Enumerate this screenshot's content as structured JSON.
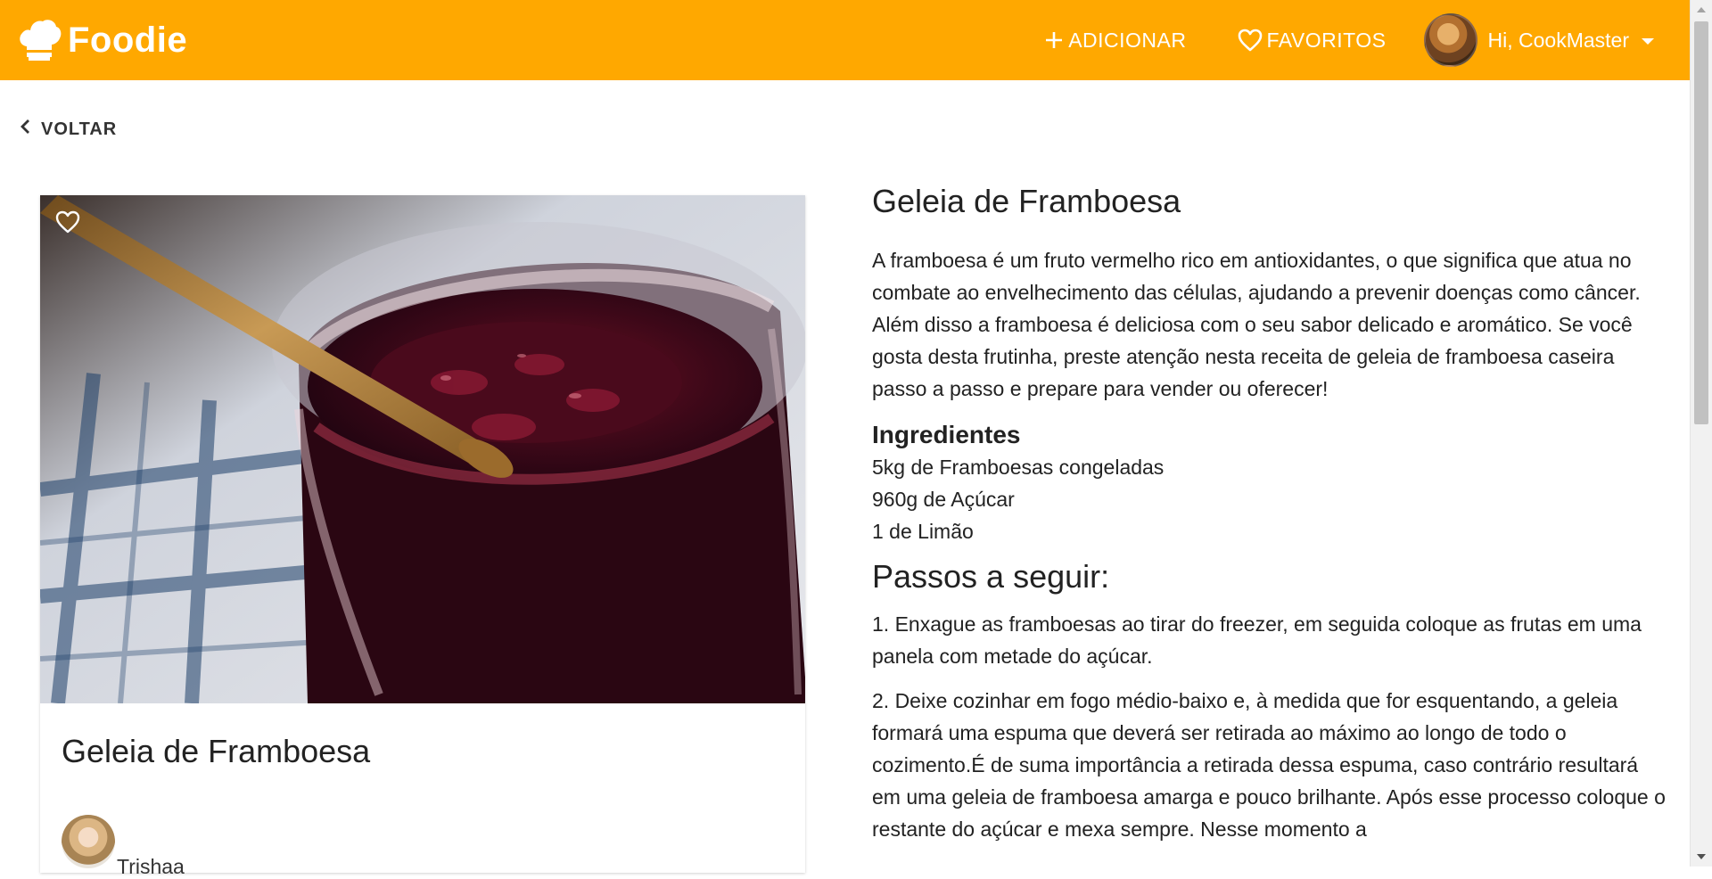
{
  "header": {
    "brand": "Foodie",
    "add_label": "ADICIONAR",
    "favorites_label": "FAVORITOS",
    "user_greeting": "Hi, CookMaster",
    "colors": {
      "accent": "#ffa800",
      "text": "#ffffff"
    }
  },
  "nav": {
    "back_label": "VOLTAR"
  },
  "card": {
    "title": "Geleia de Framboesa",
    "author": "Trishaa",
    "image_icon": "favorite-outline-icon"
  },
  "recipe": {
    "title": "Geleia de Framboesa",
    "description": "A framboesa é um fruto vermelho rico em antioxidantes, o que significa que atua no combate ao envelhecimento das células, ajudando a prevenir doenças como câncer. Além disso a framboesa é deliciosa com o seu sabor delicado e aromático. Se você gosta desta frutinha, preste atenção nesta receita de geleia de framboesa caseira passo a passo e prepare para vender ou oferecer!",
    "ingredients_heading": "Ingredientes",
    "ingredients": [
      "5kg de Framboesas congeladas",
      "960g de Açúcar",
      "1 de Limão"
    ],
    "steps_heading": "Passos a seguir:",
    "steps": [
      "1. Enxague as framboesas ao tirar do freezer, em seguida coloque as frutas em uma panela com metade do açúcar.",
      "2. Deixe cozinhar em fogo médio-baixo e, à medida que for esquentando, a geleia formará uma espuma que deverá ser retirada ao máximo ao longo de todo o cozimento.É de suma importância a retirada dessa espuma, caso contrário resultará em uma geleia de framboesa amarga e pouco brilhante. Após esse processo coloque o restante do açúcar e mexa sempre. Nesse momento a"
    ]
  }
}
